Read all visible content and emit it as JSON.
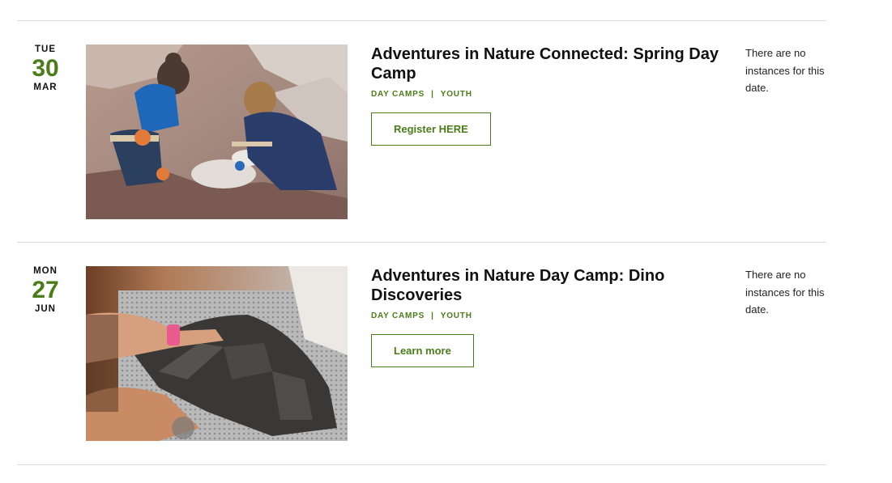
{
  "events": [
    {
      "date": {
        "dow": "TUE",
        "day": "30",
        "month": "MAR"
      },
      "title": "Adventures in Nature Connected: Spring Day Camp",
      "tags": [
        "DAY CAMPS",
        "YOUTH"
      ],
      "tag_separator": "|",
      "cta_label": "Register HERE",
      "note": "There are no instances for this date.",
      "image_icon": "photo-fossil-dig"
    },
    {
      "date": {
        "dow": "MON",
        "day": "27",
        "month": "JUN"
      },
      "title": "Adventures in Nature Day Camp: Dino Discoveries",
      "tags": [
        "DAY CAMPS",
        "YOUTH"
      ],
      "tag_separator": "|",
      "cta_label": "Learn more",
      "note": "There are no instances for this date.",
      "image_icon": "photo-dinosaur-fossil"
    }
  ],
  "colors": {
    "accent": "#4a7c1a",
    "divider": "#dcdcdc",
    "text": "#111111"
  }
}
